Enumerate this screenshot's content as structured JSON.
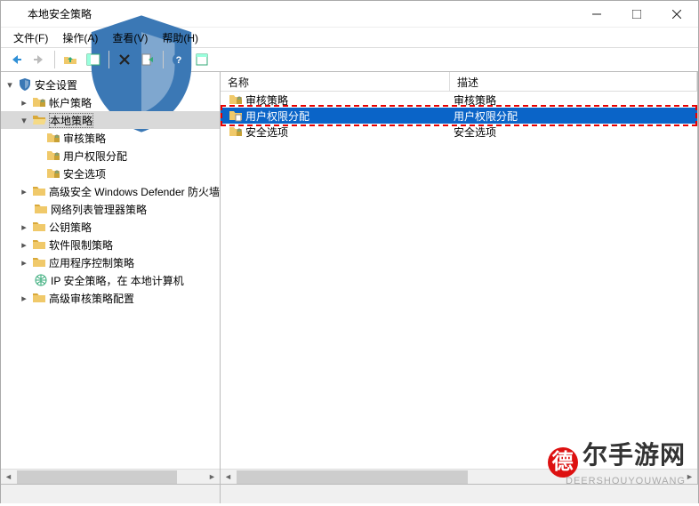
{
  "window": {
    "title": "本地安全策略"
  },
  "menus": {
    "file": "文件(F)",
    "action": "操作(A)",
    "view": "查看(V)",
    "help": "帮助(H)"
  },
  "tree": {
    "root": "安全设置",
    "items": [
      {
        "label": "帐户策略"
      },
      {
        "label": "本地策略"
      },
      {
        "label": "审核策略"
      },
      {
        "label": "用户权限分配"
      },
      {
        "label": "安全选项"
      },
      {
        "label": "高级安全 Windows Defender 防火墙"
      },
      {
        "label": "网络列表管理器策略"
      },
      {
        "label": "公钥策略"
      },
      {
        "label": "软件限制策略"
      },
      {
        "label": "应用程序控制策略"
      },
      {
        "label": "IP 安全策略，在 本地计算机"
      },
      {
        "label": "高级审核策略配置"
      }
    ]
  },
  "list": {
    "cols": {
      "name": "名称",
      "desc": "描述"
    },
    "rows": [
      {
        "name": "审核策略",
        "desc": "审核策略"
      },
      {
        "name": "用户权限分配",
        "desc": "用户权限分配"
      },
      {
        "name": "安全选项",
        "desc": "安全选项"
      }
    ]
  },
  "watermark": {
    "circle": "德",
    "big": "尔手游网",
    "small": "DEERSHOUYOUWANG"
  }
}
